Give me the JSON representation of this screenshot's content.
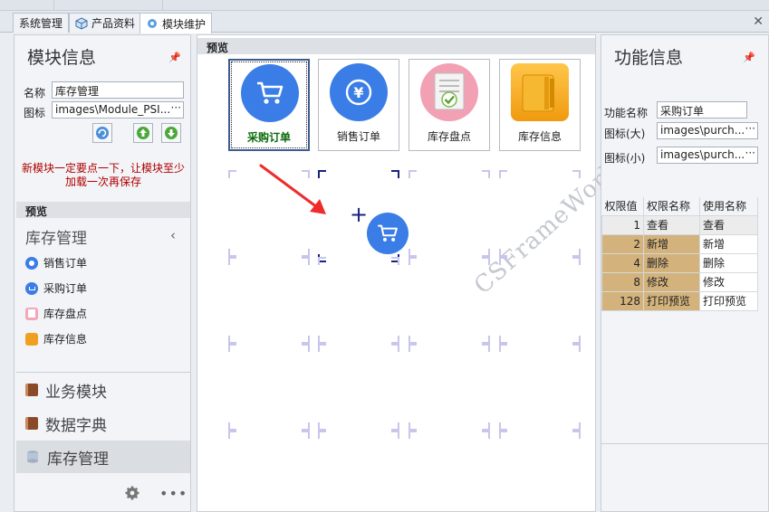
{
  "tabs": [
    {
      "label": "系统管理",
      "active": false
    },
    {
      "label": "产品资料",
      "active": false
    },
    {
      "label": "模块维护",
      "active": true
    }
  ],
  "left_panel": {
    "title": "模块信息",
    "name_label": "名称",
    "name_value": "库存管理",
    "icon_label": "图标",
    "icon_value": "images\\Module_PSI...",
    "warning": [
      "新模块一定要点一下，让模块至少",
      "加载一次再保存"
    ],
    "preview_header": "预览",
    "nav_title": "库存管理",
    "nav_items": [
      {
        "label": "销售订单",
        "icon": "yen-circle-icon"
      },
      {
        "label": "采购订单",
        "icon": "cart-circle-icon"
      },
      {
        "label": "库存盘点",
        "icon": "checklist-icon"
      },
      {
        "label": "库存信息",
        "icon": "folders-icon"
      }
    ],
    "groups": [
      {
        "label": "业务模块",
        "icon": "book-icon"
      },
      {
        "label": "数据字典",
        "icon": "book-icon"
      },
      {
        "label": "库存管理",
        "icon": "database-icon",
        "selected": true
      }
    ]
  },
  "center": {
    "preview_header": "预览",
    "tiles": [
      {
        "label": "采购订单",
        "icon": "cart-icon",
        "selected": true
      },
      {
        "label": "销售订单",
        "icon": "yen-icon",
        "selected": false
      },
      {
        "label": "库存盘点",
        "icon": "checklist-icon",
        "selected": false
      },
      {
        "label": "库存信息",
        "icon": "folders-icon",
        "selected": false
      }
    ],
    "watermark": "CSFrameWork.COM"
  },
  "right_panel": {
    "title": "功能信息",
    "func_name_label": "功能名称",
    "func_name_value": "采购订单",
    "icon_large_label": "图标(大)",
    "icon_large_value": "images\\purch...",
    "icon_small_label": "图标(小)",
    "icon_small_value": "images\\purch...",
    "columns": [
      "权限值",
      "权限名称",
      "使用名称"
    ],
    "rows": [
      {
        "value": "1",
        "name": "查看",
        "use": "查看"
      },
      {
        "value": "2",
        "name": "新增",
        "use": "新增"
      },
      {
        "value": "4",
        "name": "删除",
        "use": "删除"
      },
      {
        "value": "8",
        "name": "修改",
        "use": "修改"
      },
      {
        "value": "128",
        "name": "打印预览",
        "use": "打印预览"
      }
    ]
  },
  "colors": {
    "accent_blue": "#3b7de6",
    "warning_red": "#b00000",
    "tan": "#d4b27c"
  }
}
